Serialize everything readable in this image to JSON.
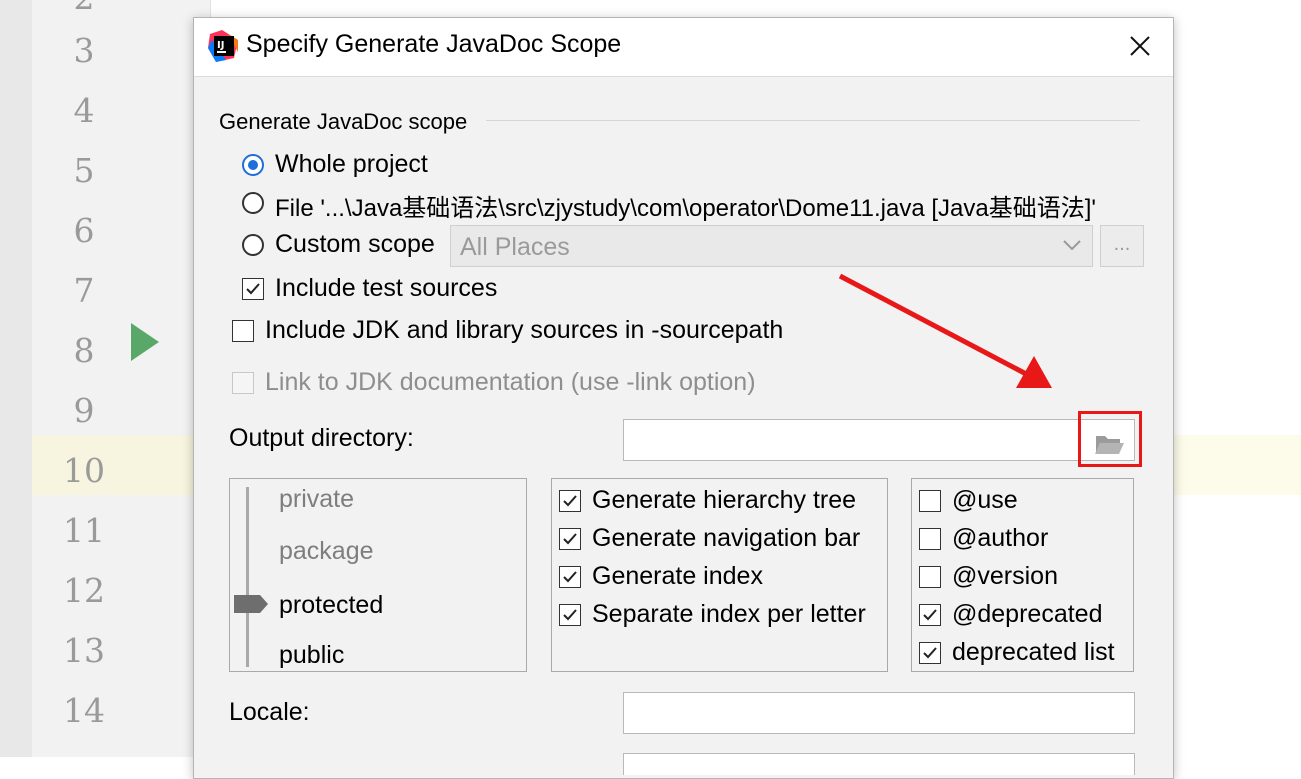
{
  "editor": {
    "line_numbers": [
      "2",
      "3",
      "4",
      "5",
      "6",
      "7",
      "8",
      "9",
      "10",
      "11",
      "12",
      "13",
      "14"
    ]
  },
  "dialog": {
    "title": "Specify Generate JavaDoc Scope",
    "scope_section_label": "Generate JavaDoc scope",
    "radio_whole_project": "Whole project",
    "radio_file": "File '...\\Java基础语法\\src\\zjystudy\\com\\operator\\Dome11.java [Java基础语法]'",
    "radio_custom_scope": "Custom scope",
    "custom_scope_value": "All Places",
    "dots_button": "...",
    "include_test_sources": "Include test sources",
    "include_jdk_sources": "Include JDK and library sources in -sourcepath",
    "link_jdk_docs": "Link to JDK documentation (use -link option)",
    "output_directory_label": "Output directory:",
    "output_directory_value": "",
    "visibility_levels": [
      "private",
      "package",
      "protected",
      "public"
    ],
    "visibility_selected": "protected",
    "generate_options": [
      {
        "label": "Generate hierarchy tree",
        "checked": true
      },
      {
        "label": "Generate navigation bar",
        "checked": true
      },
      {
        "label": "Generate index",
        "checked": true
      },
      {
        "label": "Separate index per letter",
        "checked": true
      }
    ],
    "tag_options": [
      {
        "label": "@use",
        "checked": false
      },
      {
        "label": "@author",
        "checked": false
      },
      {
        "label": "@version",
        "checked": false
      },
      {
        "label": "@deprecated",
        "checked": true
      },
      {
        "label": "deprecated list",
        "checked": true
      }
    ],
    "locale_label": "Locale:",
    "locale_value": ""
  },
  "colors": {
    "accent": "#1e6fd9",
    "annotation_red": "#e81818",
    "run_green": "#59a869"
  }
}
